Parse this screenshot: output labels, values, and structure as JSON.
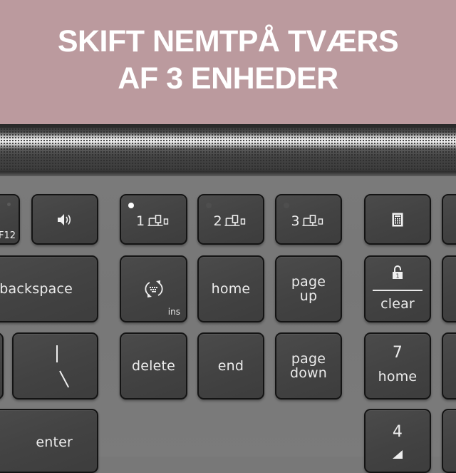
{
  "banner": {
    "line1": "SKIFT NEMTPÅ TVÆRS",
    "line2": "AF 3 ENHEDER",
    "background_color": "#bb9a9e"
  },
  "keyboard": {
    "row1": {
      "f12_key": {
        "label": "F12"
      },
      "volume_key": {
        "icon": "speaker-volume-icon"
      },
      "easy_switch_keys": [
        {
          "number": "1",
          "icon": "computer-phone-icon",
          "led_active": true
        },
        {
          "number": "2",
          "icon": "computer-phone-icon",
          "led_active": false
        },
        {
          "number": "3",
          "icon": "computer-phone-icon",
          "led_active": false
        }
      ],
      "calculator_key": {
        "icon": "calculator-icon"
      }
    },
    "row2": {
      "backspace_key": {
        "label": "backspace"
      },
      "insert_key": {
        "icon": "keyboard-swap-icon",
        "sub_label": "ins"
      },
      "home_key": {
        "label": "home"
      },
      "page_up_key": {
        "line1": "page",
        "line2": "up"
      },
      "clear_key": {
        "icon": "numlock-1-icon",
        "label": "clear"
      }
    },
    "row3": {
      "backslash_key": {
        "top": "|",
        "bottom": "\\"
      },
      "delete_key": {
        "label": "delete"
      },
      "end_key": {
        "label": "end"
      },
      "page_down_key": {
        "line1": "page",
        "line2": "down"
      },
      "numpad7_key": {
        "number": "7",
        "label": "home"
      }
    },
    "row4": {
      "enter_key": {
        "label": "enter"
      },
      "numpad4_key": {
        "number": "4"
      }
    }
  }
}
